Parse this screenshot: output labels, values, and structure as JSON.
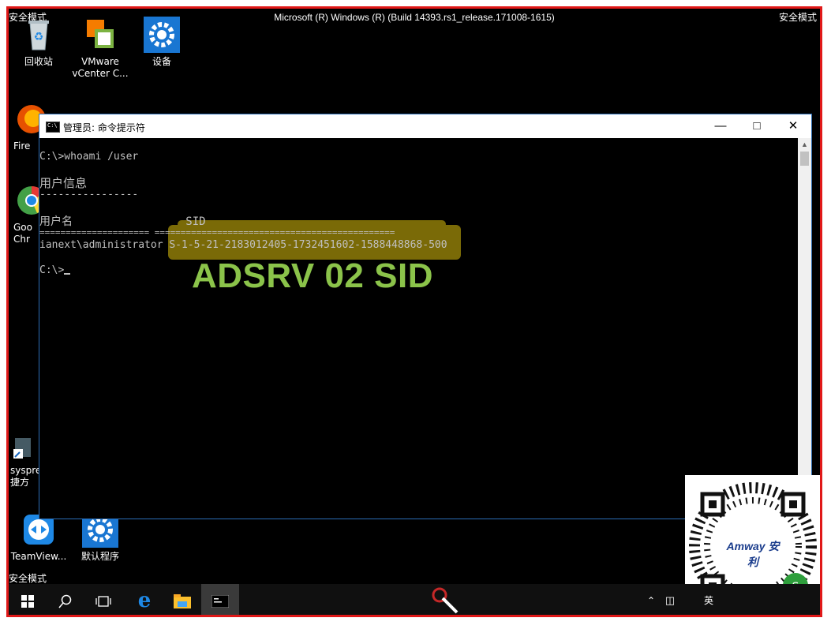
{
  "os": {
    "title": "Microsoft (R) Windows (R) (Build 14393.rs1_release.171008-1615)",
    "safe_mode": "安全模式"
  },
  "desktop_icons": [
    {
      "label": "回收站",
      "icon": "recycle-bin-icon"
    },
    {
      "label": "VMware\nvCenter C...",
      "icon": "vmware-icon"
    },
    {
      "label": "设备",
      "icon": "settings-gear-icon"
    },
    {
      "label": "Fire",
      "icon": "firefox-icon"
    },
    {
      "label": "Goo\nChr",
      "icon": "chrome-icon"
    },
    {
      "label": "syspre\n捷方",
      "icon": "shortcut-icon"
    },
    {
      "label": "TeamView...",
      "icon": "teamviewer-icon"
    },
    {
      "label": "默认程序",
      "icon": "default-programs-icon"
    }
  ],
  "cmd": {
    "title": "管理员: 命令提示符",
    "lines": [
      "C:\\>whoami /user",
      "",
      "用户信息",
      "----------------",
      "",
      "用户名                 SID",
      "===================== ==============================================",
      "ianext\\administrator S-1-5-21-2183012405-1732451602-1588448868-500",
      "",
      "C:\\>"
    ]
  },
  "annotation": {
    "caption": "ADSRV 02 SID",
    "highlight_color": "#7a6a07",
    "caption_color": "#8bc34a"
  },
  "taskbar": {
    "buttons": [
      "windows-start-icon",
      "search-icon",
      "task-view-icon",
      "edge-icon",
      "file-explorer-icon",
      "cmd-taskbar-icon"
    ],
    "tray_lang": "英"
  },
  "qr_brand": "Amway 安利"
}
